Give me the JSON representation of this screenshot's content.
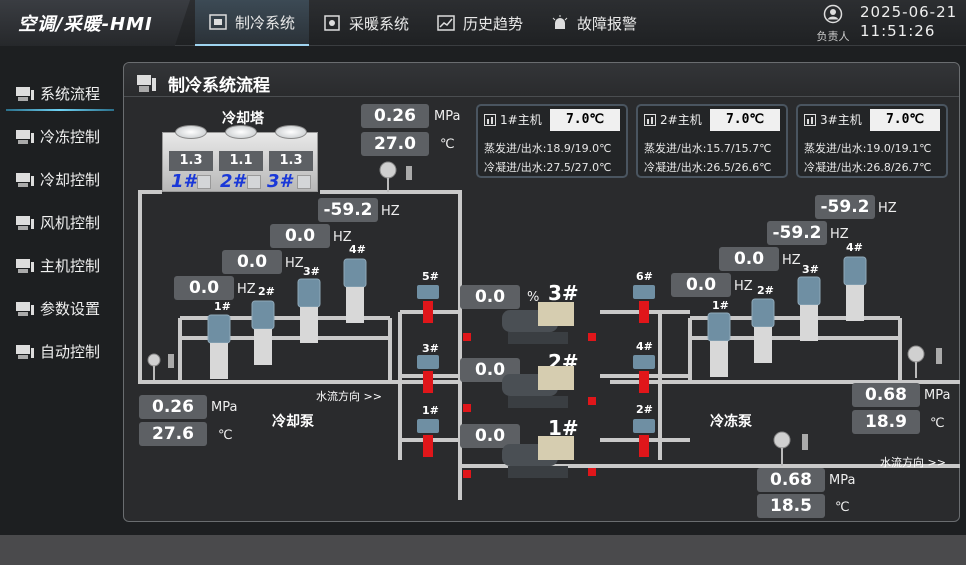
{
  "app": {
    "title": "空调/采暖-HMI"
  },
  "nav": [
    {
      "label": "制冷系统",
      "icon": "snowflake-screen-icon"
    },
    {
      "label": "采暖系统",
      "icon": "heating-icon"
    },
    {
      "label": "历史趋势",
      "icon": "trend-chart-icon"
    },
    {
      "label": "故障报警",
      "icon": "alarm-icon"
    }
  ],
  "user": {
    "label": "负责人"
  },
  "datetime": {
    "date": "2025-06-21",
    "time": "11:51:26"
  },
  "sidebar": [
    {
      "label": "系统流程"
    },
    {
      "label": "冷冻控制"
    },
    {
      "label": "冷却控制"
    },
    {
      "label": "风机控制"
    },
    {
      "label": "主机控制"
    },
    {
      "label": "参数设置"
    },
    {
      "label": "自动控制"
    }
  ],
  "panel": {
    "title": "制冷系统流程"
  },
  "tower": {
    "label": "冷却塔",
    "cells": [
      "1.3",
      "1.1",
      "1.3"
    ],
    "ids": [
      "1#",
      "2#",
      "3#"
    ]
  },
  "tower_out": {
    "pressure": "0.26",
    "pressure_unit": "MPa",
    "temp": "27.0",
    "temp_unit": "℃"
  },
  "hosts": [
    {
      "title": "1#主机",
      "temp": "7.0℃",
      "evap_label": "蒸发进/出水:",
      "evap": "18.9/19.0℃",
      "cond_label": "冷凝进/出水:",
      "cond": "27.5/27.0℃"
    },
    {
      "title": "2#主机",
      "temp": "7.0℃",
      "evap_label": "蒸发进/出水:",
      "evap": "15.7/15.7℃",
      "cond_label": "冷凝进/出水:",
      "cond": "26.5/26.6℃"
    },
    {
      "title": "3#主机",
      "temp": "7.0℃",
      "evap_label": "蒸发进/出水:",
      "evap": "19.0/19.1℃",
      "cond_label": "冷凝进/出水:",
      "cond": "26.8/26.7℃"
    }
  ],
  "cooling_pumps": {
    "label": "冷却泵",
    "freqs": [
      "-59.2",
      "0.0",
      "0.0",
      "0.0"
    ],
    "freq_unit": "HZ",
    "ids": [
      "1#",
      "2#",
      "3#",
      "4#"
    ],
    "in_pressure": "0.26",
    "in_temp": "27.6",
    "pressure_unit": "MPa",
    "temp_unit": "℃",
    "flow": "水流方向 >>"
  },
  "chilled_pumps": {
    "label": "冷冻泵",
    "freqs": [
      "-59.2",
      "-59.2",
      "0.0",
      "0.0"
    ],
    "freq_unit": "HZ",
    "ids": [
      "1#",
      "2#",
      "3#",
      "4#"
    ],
    "out_pressure": "0.68",
    "out_temp": "18.9",
    "in_pressure": "0.68",
    "in_temp": "18.5",
    "pressure_unit": "MPa",
    "temp_unit": "℃",
    "flow": "水流方向 >>"
  },
  "chillers": [
    {
      "id": "3#",
      "load": "0.0",
      "unit": "%"
    },
    {
      "id": "2#",
      "load": "0.0",
      "unit": ""
    },
    {
      "id": "1#",
      "load": "0.0",
      "unit": ""
    }
  ],
  "valves_left": [
    "5#",
    "3#",
    "1#"
  ],
  "valves_right": [
    "6#",
    "4#",
    "2#"
  ]
}
